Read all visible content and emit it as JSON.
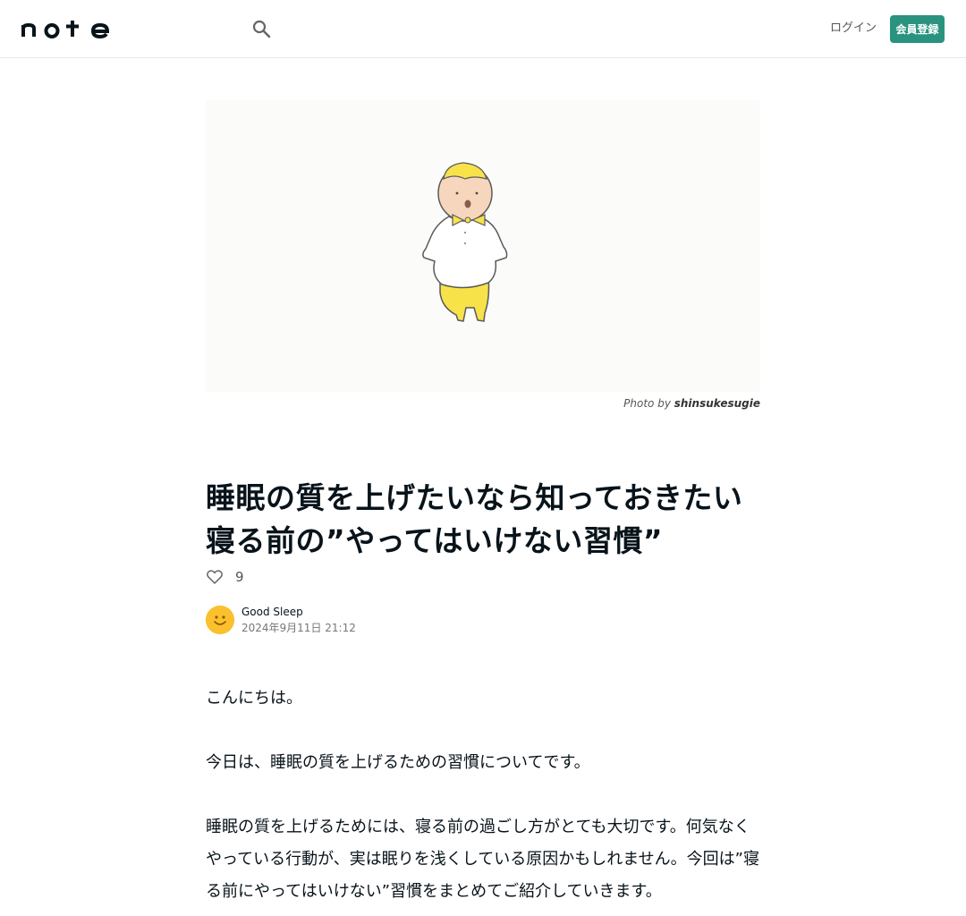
{
  "header": {
    "logo_text": "note",
    "login_label": "ログイン",
    "signup_label": "会員登録"
  },
  "icons": {
    "search": "search-icon",
    "like": "heart-icon",
    "avatar": "smiley-face"
  },
  "colors": {
    "accent": "#2a9380",
    "avatar": "#fbc02d",
    "illustration_yellow": "#f7e24a"
  },
  "hero": {
    "credit_prefix": "Photo by",
    "credit_author": "shinsukesugie"
  },
  "article": {
    "title": "睡眠の質を上げたいなら知っておきたい寝る前の”やってはいけない習慣”",
    "like_count": "9",
    "author_name": "Good Sleep",
    "date": "2024年9月11日 21:12",
    "paragraphs": [
      "こんにちは。",
      "今日は、睡眠の質を上げるための習慣についてです。",
      "睡眠の質を上げるためには、寝る前の過ごし方がとても大切です。何気なくやっている行動が、実は眠りを浅くしている原因かもしれません。今回は”寝る前にやってはいけない”習慣をまとめてご紹介していきます。"
    ]
  }
}
